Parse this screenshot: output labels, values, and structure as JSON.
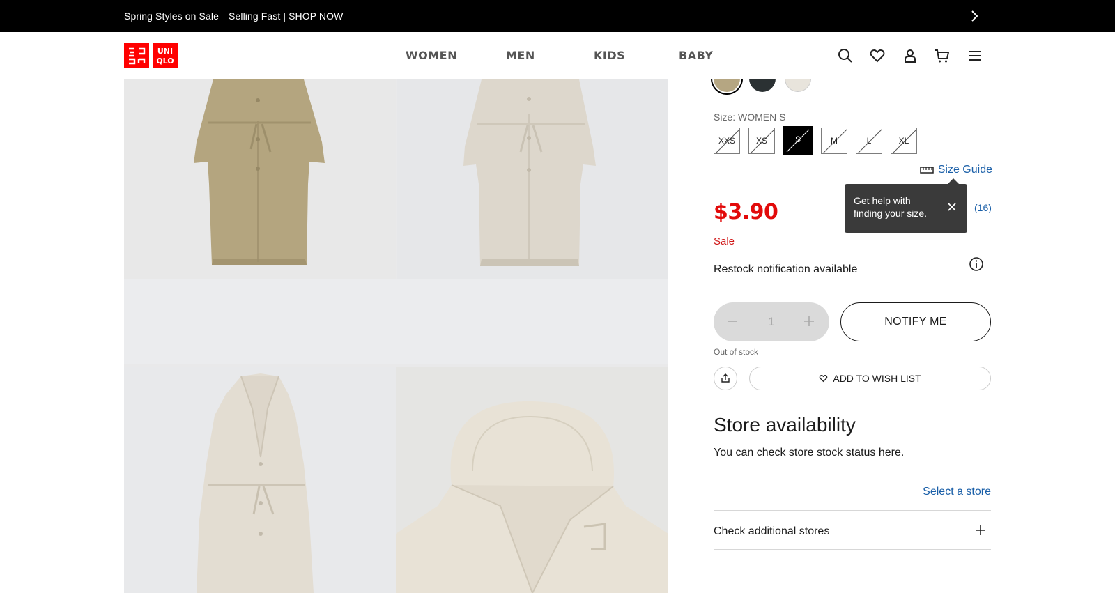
{
  "promo": {
    "text": "Spring Styles on Sale—Selling Fast | SHOP NOW",
    "next_icon": "chevron-right-icon"
  },
  "header": {
    "logo": {
      "top": "UNI",
      "bottom": "QLO",
      "color": "#ff0000"
    },
    "nav": [
      "WOMEN",
      "MEN",
      "KIDS",
      "BABY"
    ],
    "icons": [
      "search-icon",
      "heart-icon",
      "user-icon",
      "cart-icon",
      "menu-icon"
    ]
  },
  "product": {
    "colors": [
      "#b5a682",
      "#2b3133",
      "#e8e4dc"
    ],
    "size_label": "Size: WOMEN S",
    "sizes": [
      {
        "label": "XXS",
        "available": false,
        "selected": false
      },
      {
        "label": "XS",
        "available": false,
        "selected": false
      },
      {
        "label": "S",
        "available": false,
        "selected": true
      },
      {
        "label": "M",
        "available": false,
        "selected": false
      },
      {
        "label": "L",
        "available": false,
        "selected": false
      },
      {
        "label": "XL",
        "available": false,
        "selected": false
      }
    ],
    "size_guide": "Size Guide",
    "price": "$3.90",
    "sale_label": "Sale",
    "rating_count": "(16)",
    "tooltip": "Get help with finding your size.",
    "restock": "Restock notification available",
    "quantity": "1",
    "notify_button": "NOTIFY ME",
    "stock_status": "Out of stock",
    "wishlist_button": "ADD TO WISH LIST"
  },
  "store": {
    "title": "Store availability",
    "subtitle": "You can check store stock status here.",
    "select_store": "Select a store",
    "check_additional": "Check additional stores"
  },
  "colors": {
    "sale_red": "#e20a0a",
    "link_blue": "#1a5fa8",
    "brand_red": "#ff0000"
  }
}
